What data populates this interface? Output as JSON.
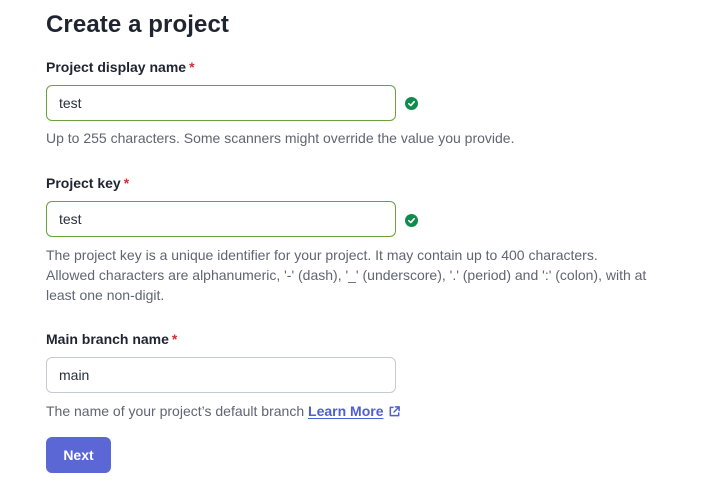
{
  "page": {
    "title": "Create a project"
  },
  "form": {
    "display_name": {
      "label": "Project display name",
      "required_marker": "*",
      "value": "test",
      "help": "Up to 255 characters. Some scanners might override the value you provide.",
      "status_icon": "check-circle-icon"
    },
    "project_key": {
      "label": "Project key",
      "required_marker": "*",
      "value": "test",
      "help_lines": [
        "The project key is a unique identifier for your project. It may contain up to 400 characters.",
        "Allowed characters are alphanumeric, '-' (dash), '_' (underscore), '.' (period) and ':' (colon), with at",
        "least one non-digit."
      ],
      "status_icon": "check-circle-icon"
    },
    "main_branch": {
      "label": "Main branch name",
      "required_marker": "*",
      "value": "main",
      "help": "The name of your project’s default branch",
      "link_label": "Learn More",
      "link_icon": "external-link-icon"
    }
  },
  "actions": {
    "next_label": "Next"
  },
  "colors": {
    "primary_button": "#5b67d4",
    "valid_border": "#6aa13b",
    "valid_icon": "#0f8c4c",
    "required": "#d02f3a",
    "link": "#4f5ed1"
  }
}
